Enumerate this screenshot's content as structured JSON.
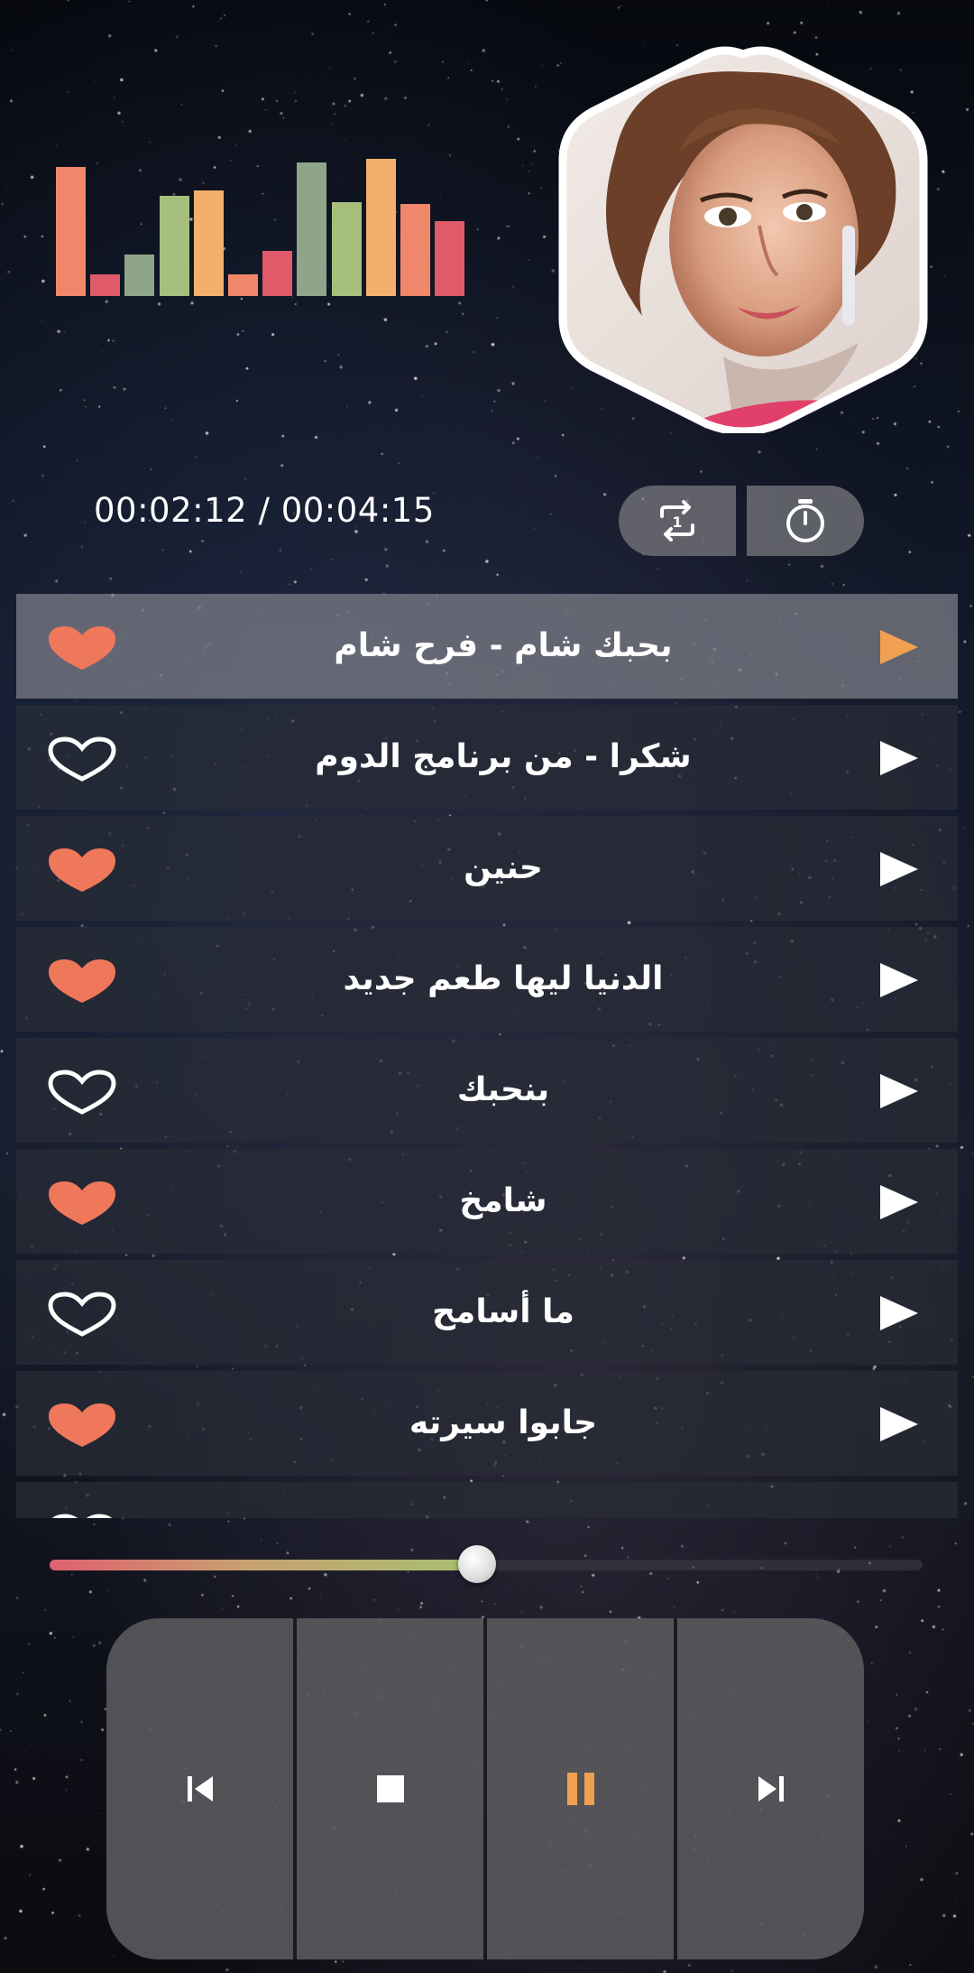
{
  "equalizer": {
    "bars": [
      {
        "level": 0.66,
        "color": "#f0876a"
      },
      {
        "level": 0.11,
        "color": "#e05a6a"
      },
      {
        "level": 0.21,
        "color": "#8fa58a"
      },
      {
        "level": 0.51,
        "color": "#a6bf7c"
      },
      {
        "level": 0.54,
        "color": "#f2b06c"
      },
      {
        "level": 0.11,
        "color": "#f0876a"
      },
      {
        "level": 0.23,
        "color": "#e05a6a"
      },
      {
        "level": 0.68,
        "color": "#8fa58a"
      },
      {
        "level": 0.48,
        "color": "#a6bf7c"
      },
      {
        "level": 0.7,
        "color": "#f2b06c"
      },
      {
        "level": 0.47,
        "color": "#f0876a"
      },
      {
        "level": 0.38,
        "color": "#e05a6a"
      }
    ]
  },
  "time": {
    "current": "00:02:12",
    "separator": " / ",
    "total": "00:04:15"
  },
  "controls": {
    "repeat_icon": "repeat-one-icon",
    "timer_icon": "stopwatch-icon"
  },
  "playlist": {
    "tracks": [
      {
        "title": "بحبك شام - فرح شام",
        "favorite": true,
        "active": true
      },
      {
        "title": "شكرا - من برنامج الدوم",
        "favorite": false,
        "active": false
      },
      {
        "title": "حنين",
        "favorite": true,
        "active": false
      },
      {
        "title": "الدنيا ليها طعم جديد",
        "favorite": true,
        "active": false
      },
      {
        "title": "بنحبك",
        "favorite": false,
        "active": false
      },
      {
        "title": "شامخ",
        "favorite": true,
        "active": false
      },
      {
        "title": "ما أسامح",
        "favorite": false,
        "active": false
      },
      {
        "title": "جابوا سيرته",
        "favorite": true,
        "active": false
      },
      {
        "title": "",
        "favorite": false,
        "active": false
      }
    ]
  },
  "progress": {
    "fraction": 0.49
  },
  "player": {
    "buttons": [
      "previous-icon",
      "stop-icon",
      "pause-icon",
      "next-icon"
    ]
  },
  "colors": {
    "accent_orange": "#f0a050",
    "heart_fill": "#f0785a",
    "active_play": "#f0a050",
    "white": "#ffffff"
  }
}
